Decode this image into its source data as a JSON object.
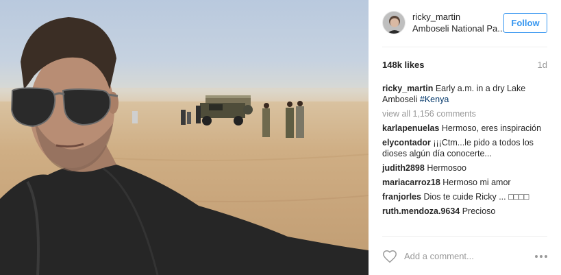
{
  "post": {
    "username": "ricky_martin",
    "location": "Amboseli National Pa...",
    "follow_label": "Follow",
    "likes": "148k likes",
    "age": "1d"
  },
  "caption": {
    "user": "ricky_martin",
    "text": "Early a.m. in a dry Lake Amboseli ",
    "hashtag": "#Kenya"
  },
  "view_all": "view all 1,156 comments",
  "comments": [
    {
      "user": "karlapenuelas",
      "text": "Hermoso, eres inspiración"
    },
    {
      "user": "elycontador",
      "text": "¡¡¡Ctm...le pido a todos los dioses algún día conocerte..."
    },
    {
      "user": "judith2898",
      "text": "Hermosoo"
    },
    {
      "user": "mariacarroz18",
      "text": "Hermoso mi amor"
    },
    {
      "user": "franjorles",
      "text": "Dios te cuide Ricky ... □□□□"
    },
    {
      "user": "ruth.mendoza.9634",
      "text": "Precioso"
    }
  ],
  "add_comment_placeholder": "Add a comment...",
  "colors": {
    "accent": "#3897f0",
    "muted": "#999999",
    "hashtag": "#003569"
  }
}
